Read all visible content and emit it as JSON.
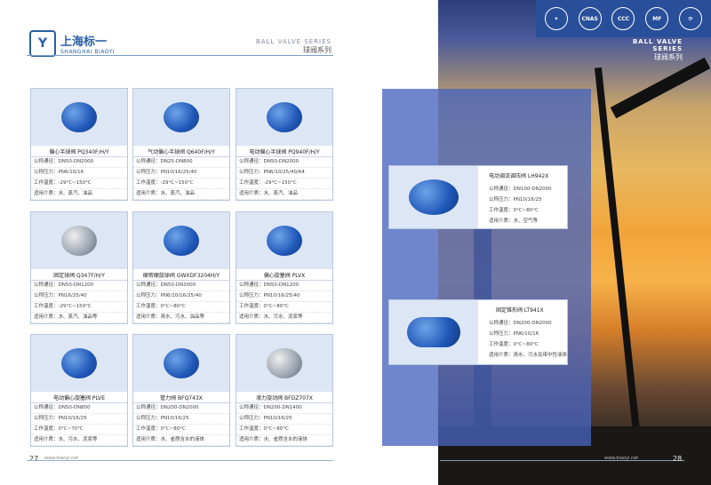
{
  "brand": {
    "logo": "Y",
    "name_cn": "上海标一",
    "name_en": "SHANGHAI BIAOYI"
  },
  "series": {
    "en": "BALL VALVE SERIES",
    "cn": "球阀系列"
  },
  "certs": [
    "✦",
    "CNAS",
    "CCC",
    "MF",
    "⟳"
  ],
  "colors": {
    "accent": "#2b5fa5",
    "card_bg": "#dce6f4",
    "cert_bar": "#2a4f9a"
  },
  "cards": [
    {
      "title": "偏心半球阀  PQ340F/H/Y",
      "specs": [
        "公称通径：DN50-DN2000",
        "公称压力：PN6/10/16",
        "工作温度：-29°C~150°C",
        "适用介质：水、蒸汽、油品"
      ],
      "img": "blue"
    },
    {
      "title": "气动偏心半球阀  Q640F/H/Y",
      "specs": [
        "公称通径：DN25-DN800",
        "公称压力：PN10/16/25/40",
        "工作温度：-29°C~150°C",
        "适用介质：水、蒸汽、油品"
      ],
      "img": "blue"
    },
    {
      "title": "电动偏心半球阀  PQ940F/H/Y",
      "specs": [
        "公称通径：DN50-DN2000",
        "公称压力：PN6/10/25/40/64",
        "工作温度：-29°C~150°C",
        "适用介质：水、蒸汽、油品"
      ],
      "img": "blue"
    },
    {
      "title": "固定球阀  Q347F/H/Y",
      "specs": [
        "公称通径：DN50-DN1200",
        "公称压力：PN16/25/40",
        "工作温度：-29°C~150°C",
        "适用介质：水、蒸汽、油品等"
      ],
      "img": "silver"
    },
    {
      "title": "硬密硬旋球阀  GWXDF3204H/Y",
      "specs": [
        "公称通径：DN50-DN3000",
        "公称压力：PN6/10/16/25/40",
        "工作温度：0°C~80°C",
        "适用介质：清水、污水、油品等"
      ],
      "img": "blue"
    },
    {
      "title": "偏心旋塞阀  PLVX",
      "specs": [
        "公称通径：DN50-DN1200",
        "公称压力：PN10/16/25/40",
        "工作温度：0°C~80°C",
        "适用介质：水、污水、泥浆等"
      ],
      "img": "blue"
    },
    {
      "title": "电动偏心旋塞阀  PLVE",
      "specs": [
        "公称通径：DN50-DN800",
        "公称压力：PN10/16/25",
        "工作温度：0°C~70°C",
        "适用介质：水、污水、泥浆等"
      ],
      "img": "blue"
    },
    {
      "title": "管力阀  BFQ743X",
      "specs": [
        "公称通径：DN200-DN2000",
        "公称压力：PN10/16/25",
        "工作温度：0°C~80°C",
        "适用介质：水、雀质含水的液体"
      ],
      "img": "blue"
    },
    {
      "title": "液力旋动阀  BFDZ707X",
      "specs": [
        "公称通径：DN200-DN1400",
        "公称压力：PN10/16/25",
        "工作温度：0°C~80°C",
        "适用介质：水、雀质含水的液体"
      ],
      "img": "silver"
    }
  ],
  "right_cards": [
    {
      "title": "电动调流调压阀  LH942X",
      "specs": [
        "公称通径：DN100-DN2000",
        "公称压力：PN10/16/25",
        "工作温度：0°C~80°C",
        "适用介质：水、空气等"
      ]
    },
    {
      "title": "固定锥形阀  LT941X",
      "specs": [
        "公称通径：DN200-DN2000",
        "公称压力：PN6/10/16",
        "工作温度：0°C~80°C",
        "适用介质：清水、污水及带中性液体"
      ]
    }
  ],
  "footer": {
    "left_page": "27",
    "right_page": "28",
    "url": "www.biaoyi.net"
  }
}
